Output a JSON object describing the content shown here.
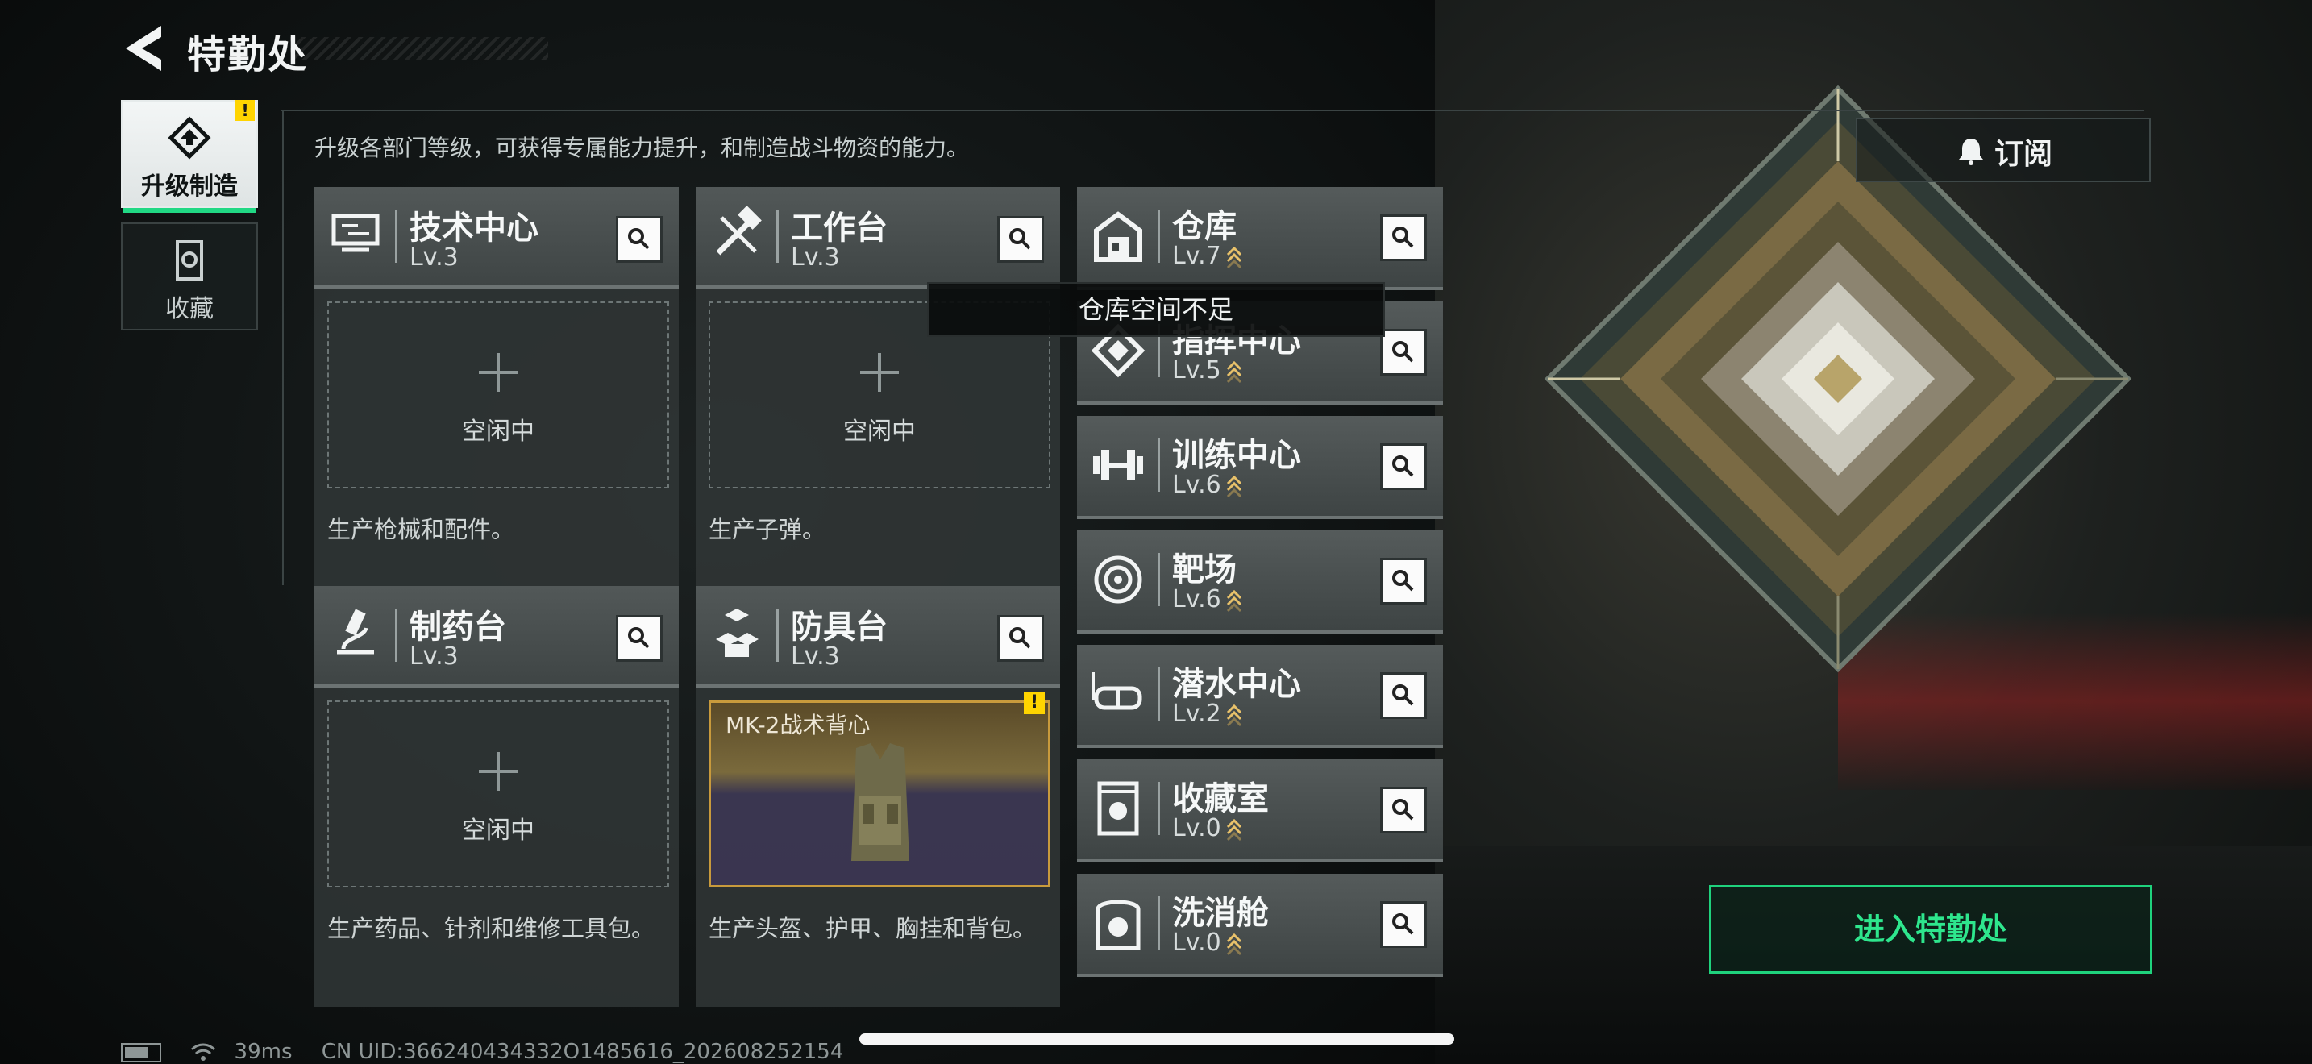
{
  "header": {
    "title": "特勤处"
  },
  "nav": [
    {
      "label": "升级制造",
      "badge": "!",
      "active": true,
      "icon": "upgrade-icon"
    },
    {
      "label": "收藏",
      "active": false,
      "icon": "collection-icon"
    }
  ],
  "subtitle": "升级各部门等级，可获得专属能力提升，和制造战斗物资的能力。",
  "subscribe": {
    "label": "订阅",
    "icon": "bell-icon"
  },
  "stations": [
    {
      "name": "技术中心",
      "level": "Lv.3",
      "slot_status": "空闲中",
      "desc": "生产枪械和配件。",
      "icon": "tech-center-icon"
    },
    {
      "name": "工作台",
      "level": "Lv.3",
      "slot_status": "空闲中",
      "desc": "生产子弹。",
      "icon": "workbench-icon"
    },
    {
      "name": "制药台",
      "level": "Lv.3",
      "slot_status": "空闲中",
      "desc": "生产药品、针剂和维修工具包。",
      "icon": "pharmacy-icon"
    },
    {
      "name": "防具台",
      "level": "Lv.3",
      "desc": "生产头盔、护甲、胸挂和背包。",
      "item_name": "MK-2战术背心",
      "item_badge": "!",
      "icon": "armor-bench-icon"
    }
  ],
  "facilities": [
    {
      "name": "仓库",
      "level": "Lv.7",
      "upgradable": true,
      "icon": "warehouse-icon"
    },
    {
      "name": "指挥中心",
      "level": "Lv.5",
      "upgradable": true,
      "icon": "command-center-icon"
    },
    {
      "name": "训练中心",
      "level": "Lv.6",
      "upgradable": true,
      "icon": "training-center-icon"
    },
    {
      "name": "靶场",
      "level": "Lv.6",
      "upgradable": true,
      "icon": "shooting-range-icon"
    },
    {
      "name": "潜水中心",
      "level": "Lv.2",
      "upgradable": true,
      "icon": "diving-center-icon"
    },
    {
      "name": "收藏室",
      "level": "Lv.0",
      "upgradable": true,
      "icon": "collection-room-icon"
    },
    {
      "name": "洗消舱",
      "level": "Lv.0",
      "upgradable": true,
      "icon": "decontamination-icon"
    }
  ],
  "tooltip": "仓库空间不足",
  "enter_button": "进入特勤处",
  "status_bar": {
    "ping": "39ms",
    "uid": "CN UID:366240434332O1485616_202608252154"
  },
  "colors": {
    "accent_green": "#21d884",
    "badge_yellow": "#ffd400",
    "item_border": "#c89a3c"
  }
}
